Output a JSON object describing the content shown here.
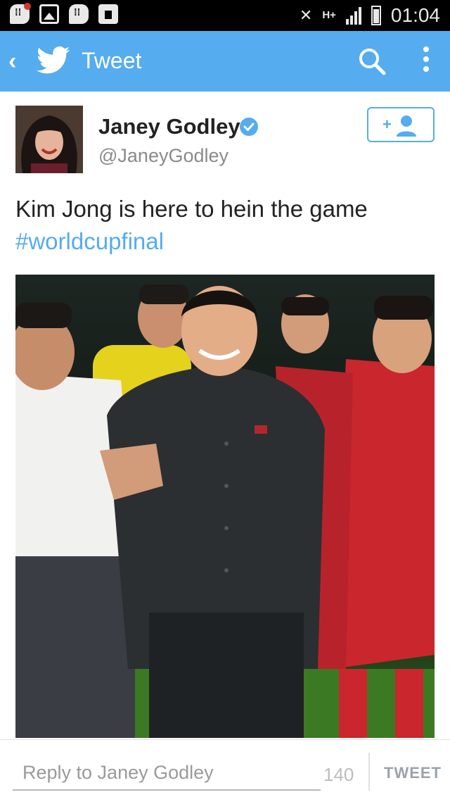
{
  "status_bar": {
    "network": "H+",
    "time": "01:04"
  },
  "action_bar": {
    "title": "Tweet",
    "back_icon": "chevron-left-icon",
    "logo_icon": "twitter-bird-icon",
    "search_icon": "search-icon",
    "overflow_icon": "overflow-menu-icon"
  },
  "tweet": {
    "author_name": "Janey Godley",
    "verified": true,
    "handle": "@JaneyGodley",
    "text": "Kim Jong is here to hein the game",
    "hashtag": "#worldcupfinal"
  },
  "reply_bar": {
    "placeholder": "Reply to Janey Godley",
    "char_count": "140",
    "tweet_button": "TWEET"
  },
  "colors": {
    "accent": "#55acee",
    "status_bar": "#000000"
  }
}
